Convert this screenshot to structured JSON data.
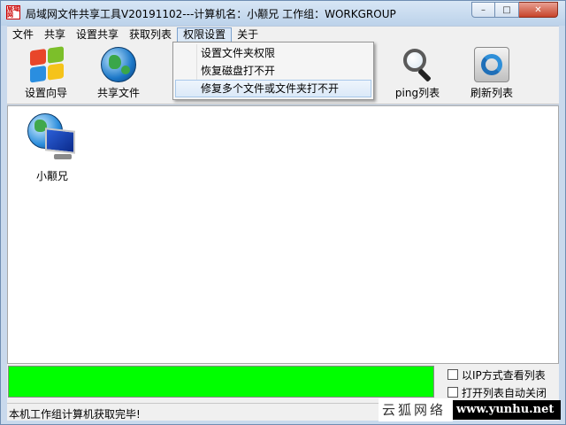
{
  "window": {
    "app_icon_text": "局域网",
    "title": "局域网文件共享工具V20191102---计算机名：小颟兄  工作组：WORKGROUP",
    "min_glyph": "–",
    "max_glyph": "□",
    "close_glyph": "✕"
  },
  "menu": {
    "items": [
      "文件",
      "共享",
      "设置共享",
      "获取列表",
      "权限设置",
      "关于"
    ],
    "active": "权限设置"
  },
  "dropdown": {
    "items": [
      "设置文件夹权限",
      "恢复磁盘打不开",
      "修复多个文件或文件夹打不开"
    ],
    "hover_index": 2
  },
  "toolbar": {
    "buttons": [
      {
        "label": "设置向导",
        "icon": "windows-logo-icon"
      },
      {
        "label": "共享文件",
        "icon": "globe-icon"
      },
      {
        "label": "ping列表",
        "icon": "magnifier-icon"
      },
      {
        "label": "刷新列表",
        "icon": "refresh-icon"
      }
    ]
  },
  "computers": [
    {
      "name": "小颟兄",
      "icon": "network-computer-icon"
    }
  ],
  "options": {
    "ip_view": "以IP方式查看列表",
    "auto_close": "打开列表自动关闭"
  },
  "progress": {
    "value": 1.0,
    "color": "#00ff00"
  },
  "status": {
    "text": "本机工作组计算机获取完毕!"
  },
  "watermark": {
    "cn": "云狐网络",
    "url": "www.yunhu.net"
  },
  "colors": {
    "frame": "#c9d9ec",
    "progress": "#00ff00",
    "close_button": "#c7432a"
  }
}
